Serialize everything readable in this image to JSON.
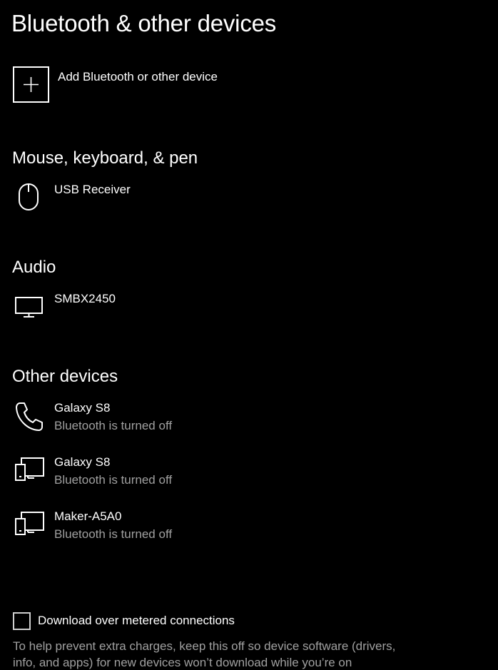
{
  "page": {
    "title": "Bluetooth & other devices"
  },
  "add_device": {
    "label": "Add Bluetooth or other device",
    "icon": "plus-icon"
  },
  "sections": {
    "input": {
      "heading": "Mouse, keyboard, & pen",
      "devices": [
        {
          "name": "USB Receiver",
          "status": "",
          "icon": "mouse-icon"
        }
      ]
    },
    "audio": {
      "heading": "Audio",
      "devices": [
        {
          "name": "SMBX2450",
          "status": "",
          "icon": "monitor-icon"
        }
      ]
    },
    "other": {
      "heading": "Other devices",
      "devices": [
        {
          "name": "Galaxy S8",
          "status": "Bluetooth is turned off",
          "icon": "phone-icon"
        },
        {
          "name": "Galaxy S8",
          "status": "Bluetooth is turned off",
          "icon": "devices-icon"
        },
        {
          "name": "Maker-A5A0",
          "status": "Bluetooth is turned off",
          "icon": "devices-icon"
        }
      ]
    }
  },
  "metered": {
    "label": "Download over metered connections",
    "checked": false,
    "help_text": "To help prevent extra charges, keep this off so device software (drivers, info, and apps) for new devices won’t download while you’re on"
  },
  "colors": {
    "background": "#000000",
    "text": "#ffffff",
    "secondary_text": "#a0a0a0"
  }
}
